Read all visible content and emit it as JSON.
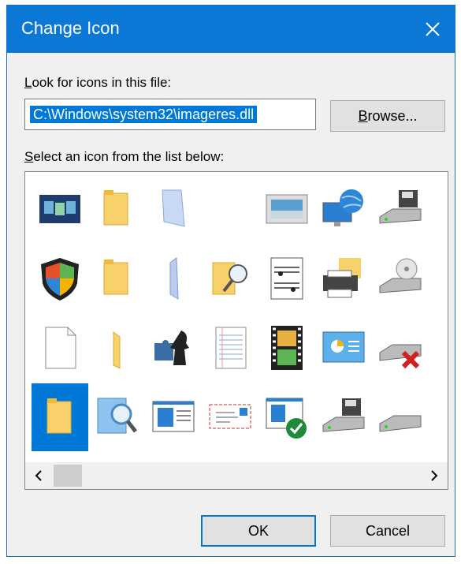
{
  "window": {
    "title": "Change Icon"
  },
  "labels": {
    "look_for": {
      "pre": "",
      "accel": "L",
      "post": "ook for icons in this file:"
    },
    "select": {
      "pre": "",
      "accel": "S",
      "post": "elect an icon from the list below:"
    }
  },
  "file_path": "C:\\Windows\\system32\\imageres.dll",
  "buttons": {
    "browse": {
      "pre": "",
      "accel": "B",
      "post": "rowse..."
    },
    "ok": "OK",
    "cancel": "Cancel"
  },
  "icons": [
    [
      "app-windows-icon",
      "folder-icon",
      "folder-blank-icon",
      "",
      "picture-frame-icon",
      "globe-monitor-icon",
      "drive-floppy-icon",
      "drive-partial-icon"
    ],
    [
      "security-shield-icon",
      "folder-icon",
      "folder-thin-icon",
      "folder-search-icon",
      "sheet-music-icon",
      "printer-folder-icon",
      "drive-optical-icon",
      "drive-partial-icon"
    ],
    [
      "blank-document-icon",
      "folder-sliver-icon",
      "puzzle-chess-icon",
      "lined-document-icon",
      "film-strip-icon",
      "control-panel-icon",
      "drive-disconnected-icon",
      "drive-partial-icon"
    ],
    [
      "folder-icon",
      "search-icon",
      "window-layout-icon",
      "envelope-icon",
      "window-checkmark-icon",
      "drive-floppy-icon",
      "drive-icon",
      "windows-logo-icon"
    ]
  ],
  "selected_icon": {
    "row": 3,
    "col": 0
  },
  "colors": {
    "accent": "#0078d7",
    "titlebar": "#0a78d4",
    "folder": "#f7d26b"
  }
}
